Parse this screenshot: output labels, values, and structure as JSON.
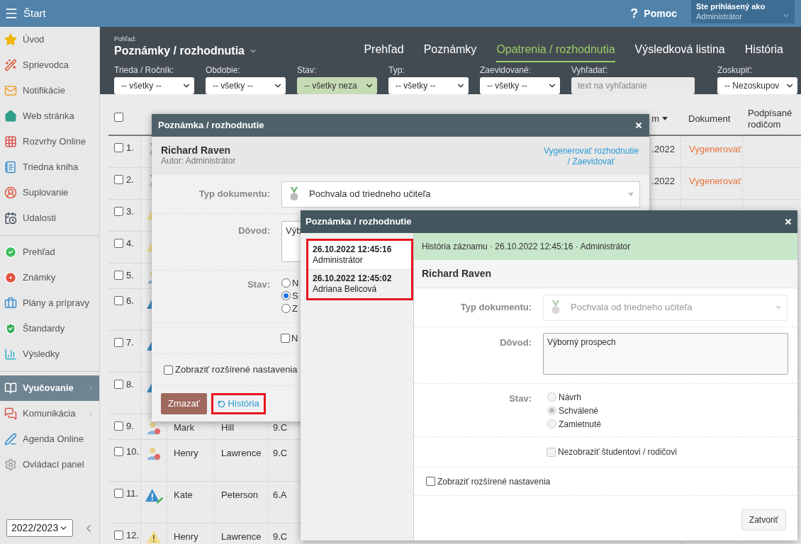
{
  "topbar": {
    "title": "Štart",
    "help_icon": "?",
    "help": "Pomoc",
    "user_caption": "Ste prihlásený ako",
    "user_name": "Administrátor"
  },
  "sidebar": {
    "sections": [
      {
        "items": [
          {
            "label": "Úvod",
            "selected": false,
            "submenu": false
          },
          {
            "label": "Sprievodca",
            "selected": false,
            "submenu": false
          },
          {
            "label": "Notifikácie",
            "selected": false,
            "submenu": false
          },
          {
            "label": "Web stránka",
            "selected": false,
            "submenu": false
          },
          {
            "label": "Rozvrhy Online",
            "selected": false,
            "submenu": false
          },
          {
            "label": "Triedna kniha",
            "selected": false,
            "submenu": false
          },
          {
            "label": "Suplovanie",
            "selected": false,
            "submenu": false
          },
          {
            "label": "Udalosti",
            "selected": false,
            "submenu": false
          }
        ]
      },
      {
        "items": [
          {
            "label": "Prehľad",
            "selected": false,
            "submenu": false
          },
          {
            "label": "Známky",
            "selected": false,
            "submenu": false
          },
          {
            "label": "Plány a prípravy",
            "selected": false,
            "submenu": false
          },
          {
            "label": "Štandardy",
            "selected": false,
            "submenu": false
          },
          {
            "label": "Výsledky",
            "selected": false,
            "submenu": false
          }
        ]
      },
      {
        "items": [
          {
            "label": "Vyučovanie",
            "selected": true,
            "submenu": true
          },
          {
            "label": "Komunikácia",
            "selected": false,
            "submenu": true
          },
          {
            "label": "Agenda Online",
            "selected": false,
            "submenu": false
          },
          {
            "label": "Ovládací panel",
            "selected": false,
            "submenu": false
          }
        ]
      }
    ],
    "year": "2022/2023"
  },
  "view": {
    "caption": "Pohľad:",
    "title": "Poznámky / rozhodnutia"
  },
  "tabs": [
    {
      "label": "Prehľad",
      "selected": false
    },
    {
      "label": "Poznámky",
      "selected": false
    },
    {
      "label": "Opatrenia / rozhodnutia",
      "selected": true
    },
    {
      "label": "Výsledková listina",
      "selected": false
    },
    {
      "label": "História",
      "selected": false
    }
  ],
  "filters": [
    {
      "label": "Trieda / Ročník:",
      "kind": "select",
      "value": "-- všetky --",
      "highlighted": false
    },
    {
      "label": "Obdobie:",
      "kind": "select",
      "value": "-- všetky --",
      "highlighted": false
    },
    {
      "label": "Stav:",
      "kind": "select",
      "value": "-- všetky neza",
      "highlighted": true
    },
    {
      "label": "Typ:",
      "kind": "select",
      "value": "-- všetky --",
      "highlighted": false
    },
    {
      "label": "Zaevidované:",
      "kind": "select",
      "value": "-- všetky --",
      "highlighted": false
    },
    {
      "label": "Vyhľadať:",
      "kind": "search",
      "placeholder": "text na vyhľadanie"
    },
    {
      "label": "Zoskupiť:",
      "kind": "select",
      "value": "-- Nezoskupov",
      "highlighted": false
    }
  ],
  "table": {
    "all_checked": false,
    "columns": [
      {
        "label": "m",
        "sorted": true
      },
      {
        "label": "Dokument"
      },
      {
        "label": "Podpísané rodičom"
      }
    ],
    "rows": [
      {
        "number": "1.",
        "checked": false,
        "kind": "medal",
        "date": ".2022",
        "document": "Vygenerovať"
      },
      {
        "number": "2.",
        "checked": false,
        "kind": "medal",
        "date": ".2022",
        "document": "Vygenerovať"
      },
      {
        "number": "3.",
        "checked": false,
        "kind": "caution"
      },
      {
        "number": "4.",
        "checked": false,
        "kind": "caution"
      },
      {
        "number": "5.",
        "checked": false,
        "kind": "person"
      },
      {
        "number": "6.",
        "checked": false,
        "kind": "notice"
      },
      {
        "number": "7.",
        "checked": false,
        "kind": "notice"
      },
      {
        "number": "8.",
        "checked": false,
        "kind": "notice"
      },
      {
        "number": "9.",
        "checked": false,
        "kind": "person-flag",
        "first_name": "Mark",
        "last_name": "Hill",
        "class": "9.C"
      },
      {
        "number": "10.",
        "checked": false,
        "kind": "person-flag",
        "first_name": "Henry",
        "last_name": "Lawrence",
        "class": "9.C"
      },
      {
        "number": "11.",
        "checked": false,
        "kind": "notice-edit",
        "first_name": "Kate",
        "last_name": "Peterson",
        "class": "6.A"
      },
      {
        "number": "12.",
        "checked": false,
        "kind": "caution",
        "first_name": "Henry",
        "last_name": "Lawrence",
        "class": "9.C"
      }
    ]
  },
  "note_dialog": {
    "title": "Poznámka / rozhodnutie",
    "student": "Richard Raven",
    "author": "Autor: Administrátor",
    "action_link": "Vygenerovať rozhodnutie / Zaevidovať",
    "document_type_label": "Typ dokumentu:",
    "document_type": "Pochvala od triedneho učiteľa",
    "reason_label": "Dôvod:",
    "reason": "Výb",
    "status_label": "Stav:",
    "status_options": [
      {
        "label": "N",
        "selected": false
      },
      {
        "label": "S",
        "selected": true
      },
      {
        "label": "Z",
        "selected": false
      }
    ],
    "hide_label": "N",
    "hide_checked": false,
    "advanced_label": "Zobraziť rozšírené nastavenia",
    "advanced_checked": false,
    "delete_button": "Zmazať",
    "history_link": "História",
    "history_highlighted": true
  },
  "history_dialog": {
    "title": "Poznámka / rozhodnutie",
    "entries_highlighted": true,
    "entries": [
      {
        "time": "26.10.2022 12:45:16",
        "user": "Administrátor",
        "selected": true
      },
      {
        "time": "26.10.2022 12:45:02",
        "user": "Adriana Belicová",
        "selected": false
      }
    ],
    "banner": "História záznamu · 26.10.2022 12:45:16 · Administrátor",
    "student": "Richard Raven",
    "disabled": true,
    "document_type_label": "Typ dokumentu:",
    "document_type": "Pochvala od triedneho učiteľa",
    "reason_label": "Dôvod:",
    "reason": "Výborný prospech",
    "status_label": "Stav:",
    "status_options": [
      {
        "label": "Návrh",
        "selected": false
      },
      {
        "label": "Schválené",
        "selected": true
      },
      {
        "label": "Zamietnuté",
        "selected": false
      }
    ],
    "hide_label": "Nezobraziť študentovi / rodičovi",
    "hide_checked": false,
    "advanced_label": "Zobraziť rozšírené nastavenia",
    "advanced_checked": false,
    "close_button": "Zatvoriť"
  }
}
